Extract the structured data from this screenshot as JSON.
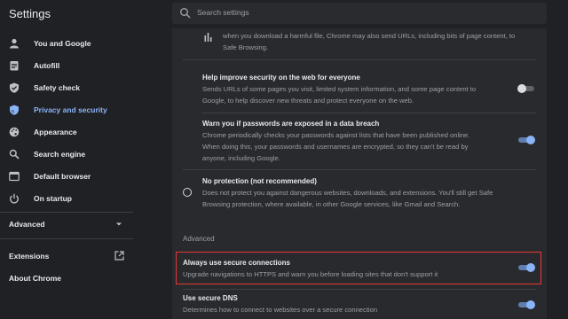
{
  "header": {
    "title": "Settings",
    "search_placeholder": "Search settings"
  },
  "sidebar": {
    "items": [
      {
        "label": "You and Google",
        "icon": "person-icon",
        "active": false
      },
      {
        "label": "Autofill",
        "icon": "clipboard-icon",
        "active": false
      },
      {
        "label": "Safety check",
        "icon": "shield-check-icon",
        "active": false
      },
      {
        "label": "Privacy and security",
        "icon": "shield-icon",
        "active": true
      },
      {
        "label": "Appearance",
        "icon": "palette-icon",
        "active": false
      },
      {
        "label": "Search engine",
        "icon": "search-icon",
        "active": false
      },
      {
        "label": "Default browser",
        "icon": "browser-icon",
        "active": false
      },
      {
        "label": "On startup",
        "icon": "power-icon",
        "active": false
      }
    ],
    "advanced_label": "Advanced",
    "extensions_label": "Extensions",
    "about_label": "About Chrome"
  },
  "content": {
    "top_partial": {
      "line1": "when you download a harmful file, Chrome may also send URLs, including bits of page content, to",
      "line2": "Safe Browsing."
    },
    "help_improve": {
      "title": "Help improve security on the web for everyone",
      "line1": "Sends URLs of some pages you visit, limited system information, and some page content to",
      "line2": "Google, to help discover new threats and protect everyone on the web.",
      "enabled": false
    },
    "password_warn": {
      "title": "Warn you if passwords are exposed in a data breach",
      "line1": "Chrome periodically checks your passwords against lists that have been published online.",
      "line2": "When doing this, your passwords and usernames are encrypted, so they can't be read by",
      "line3": "anyone, including Google.",
      "enabled": true
    },
    "no_protection": {
      "title": "No protection (not recommended)",
      "line1": "Does not protect you against dangerous websites, downloads, and extensions. You'll still get Safe",
      "line2": "Browsing protection, where available, in other Google services, like Gmail and Search.",
      "selected": false
    },
    "advanced_header": "Advanced",
    "secure_connections": {
      "title": "Always use secure connections",
      "desc": "Upgrade navigations to HTTPS and warn you before loading sites that don't support it",
      "enabled": true
    },
    "secure_dns": {
      "title": "Use secure DNS",
      "desc": "Determines how to connect to websites over a secure connection",
      "enabled": true
    }
  },
  "colors": {
    "accent": "#8ab4f8",
    "highlight": "#e53935",
    "background": "#202124",
    "panel": "#292a2d"
  }
}
